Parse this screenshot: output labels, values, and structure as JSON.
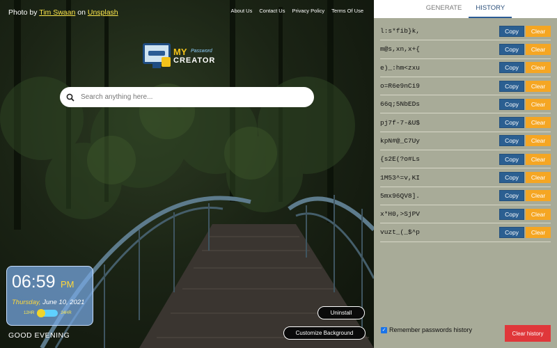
{
  "credit": {
    "prefix": "Photo by",
    "author": "Tim Swaan",
    "on": "on",
    "site": "Unsplash"
  },
  "top_links": [
    "About Us",
    "Contact Us",
    "Privacy Policy",
    "Terms Of Use"
  ],
  "logo": {
    "my": "MY",
    "password": "Password",
    "creator": "CREATOR"
  },
  "search": {
    "placeholder": "Search anything here..."
  },
  "clock": {
    "time": "06:59",
    "ampm": "PM",
    "day": "Thursday,",
    "date": "June 10, 2021",
    "label_12": "12HR",
    "label_24": "24HR"
  },
  "greeting": "GOOD EVENING",
  "buttons": {
    "uninstall": "Uninstall",
    "customize": "Customize Background"
  },
  "panel": {
    "tabs": [
      "GENERATE",
      "HISTORY"
    ],
    "active_tab": "HISTORY",
    "copy_label": "Copy",
    "clear_label": "Clear",
    "passwords": [
      "l:s*fib}k,",
      "m@s,xn,x+{",
      "e)_:hm<zxu",
      "o=R6e9nCi9",
      "66q;5NbEDs",
      "pj7f-7-&U$",
      "kpN#@_C7Uy",
      "{s2E(?o#Ls",
      "1M53^=v,KI",
      "5mx96QV8].",
      "x*H0,>SjPV",
      "vuzt_(_$^p"
    ],
    "remember_label": "Remember passwords history",
    "remember_checked": true,
    "clear_history_label": "Clear history"
  },
  "colors": {
    "copy": "#2b5f91",
    "clear": "#f5a623",
    "clear_history": "#e0373a",
    "panel_bg": "#a8ab98"
  }
}
